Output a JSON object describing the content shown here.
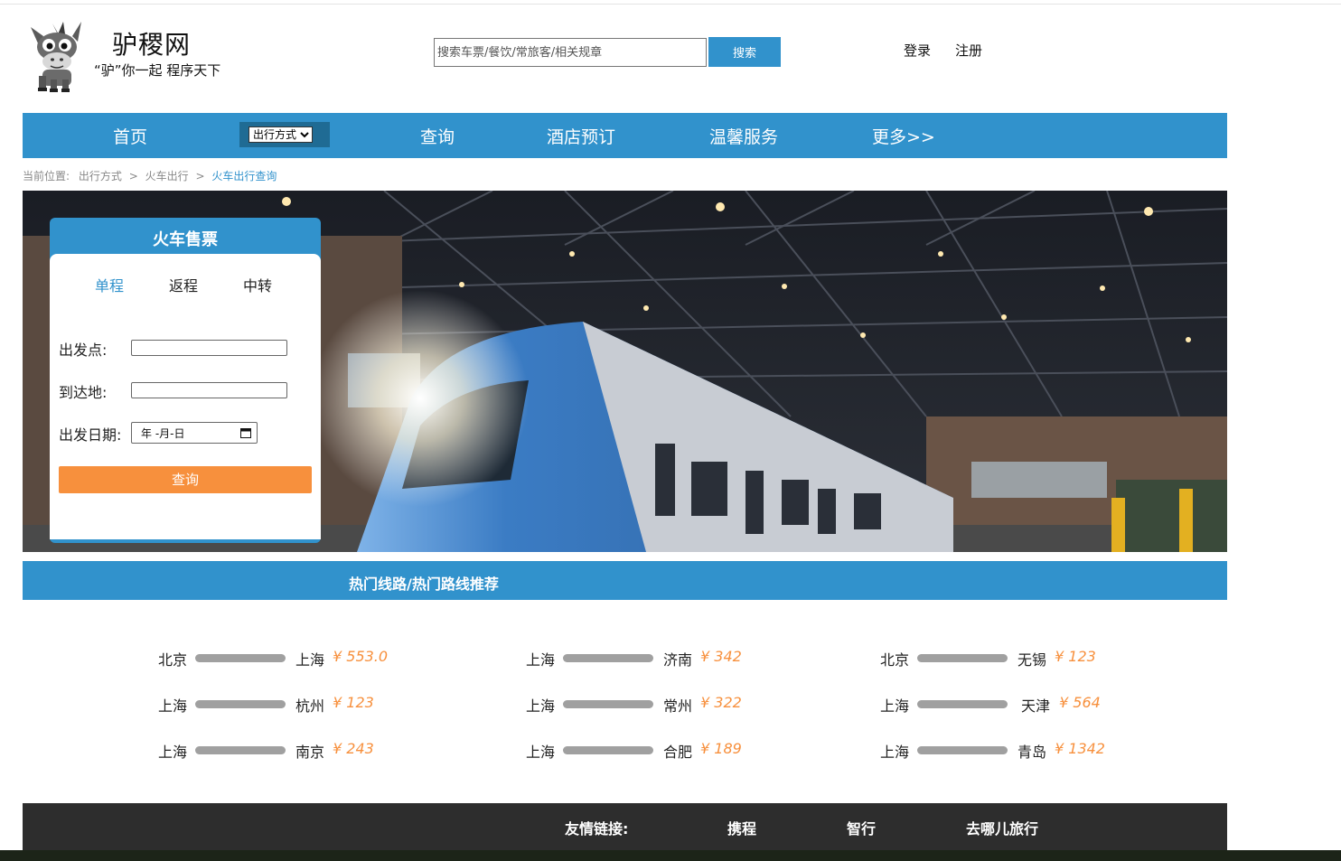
{
  "header": {
    "site_name": "驴稷网",
    "slogan": "“驴”你一起 程序天下",
    "search_placeholder": "搜索车票/餐饮/常旅客/相关规章",
    "search_button": "搜索",
    "login": "登录",
    "register": "注册"
  },
  "nav": {
    "home": "首页",
    "travel_mode_selected": "出行方式",
    "query": "查询",
    "hotel": "酒店预订",
    "service": "温馨服务",
    "more": "更多>>"
  },
  "breadcrumb": {
    "prefix": "当前位置:",
    "level1": "出行方式",
    "sep": ">",
    "level2": "火车出行",
    "current": "火车出行查询"
  },
  "ticket": {
    "title": "火车售票",
    "tabs": [
      "单程",
      "返程",
      "中转"
    ],
    "active_tab": "单程",
    "from_label": "出发点:",
    "to_label": "到达地:",
    "date_label": "出发日期:",
    "date_value": "年 -月-日",
    "query_button": "查询"
  },
  "hot": {
    "title": "热门线路/热门路线推荐",
    "routes": [
      {
        "from": "北京",
        "to": "上海",
        "price": "¥ 553.0"
      },
      {
        "from": "上海",
        "to": "济南",
        "price": "¥ 342"
      },
      {
        "from": "北京",
        "to": "无锡",
        "price": "¥ 123"
      },
      {
        "from": "上海",
        "to": "杭州",
        "price": "¥ 123"
      },
      {
        "from": "上海",
        "to": "常州",
        "price": "¥ 322"
      },
      {
        "from": "上海",
        "to": " 天津",
        "price": "¥ 564"
      },
      {
        "from": "上海",
        "to": "南京",
        "price": "¥ 243"
      },
      {
        "from": "上海",
        "to": "合肥",
        "price": "¥ 189"
      },
      {
        "from": "上海",
        "to": "青岛",
        "price": "¥ 1342"
      }
    ]
  },
  "footer": {
    "label": "友情链接:",
    "links": [
      "携程",
      "智行",
      "去哪儿旅行"
    ]
  },
  "colors": {
    "primary": "#3192cc",
    "accent": "#f7903d",
    "footer": "#2d2d2d"
  }
}
